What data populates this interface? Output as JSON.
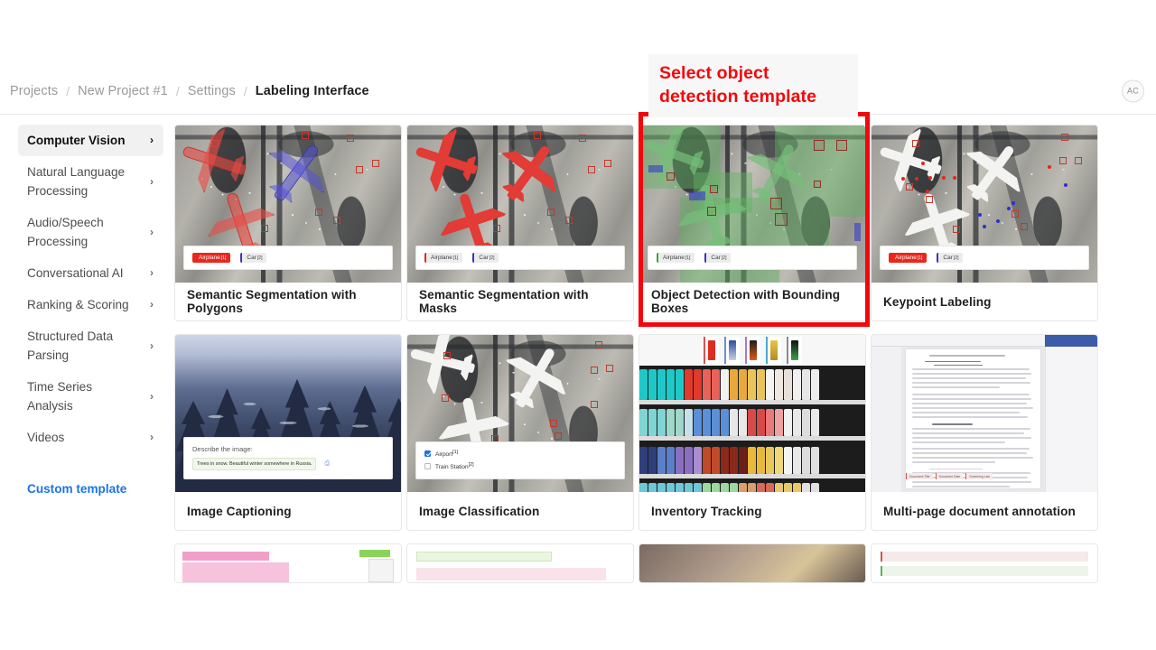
{
  "breadcrumb": {
    "items": [
      "Projects",
      "New Project #1",
      "Settings",
      "Labeling Interface"
    ],
    "separator": "/"
  },
  "account": {
    "initials": "AC"
  },
  "sidebar": {
    "items": [
      {
        "label": "Computer Vision",
        "active": true
      },
      {
        "label": "Natural Language Processing",
        "active": false
      },
      {
        "label": "Audio/Speech Processing",
        "active": false
      },
      {
        "label": "Conversational AI",
        "active": false
      },
      {
        "label": "Ranking & Scoring",
        "active": false
      },
      {
        "label": "Structured Data Parsing",
        "active": false
      },
      {
        "label": "Time Series Analysis",
        "active": false
      },
      {
        "label": "Videos",
        "active": false
      }
    ],
    "custom_template": "Custom template",
    "chevron": "›"
  },
  "annotation": {
    "text": "Select object detection template",
    "color": "#f4060b",
    "target_card": "Object Detection with Bounding Boxes"
  },
  "templates": [
    {
      "title": "Semantic Segmentation with Polygons",
      "chips": [
        {
          "text": "Airplane",
          "sup": "[1]"
        },
        {
          "text": "Car",
          "sup": "[2]"
        }
      ]
    },
    {
      "title": "Semantic Segmentation with Masks",
      "chips": [
        {
          "text": "Airplane",
          "sup": "[1]"
        },
        {
          "text": "Car",
          "sup": "[2]"
        }
      ]
    },
    {
      "title": "Object Detection with Bounding Boxes",
      "chips": [
        {
          "text": "Airplane",
          "sup": "[1]"
        },
        {
          "text": "Car",
          "sup": "[2]"
        }
      ]
    },
    {
      "title": "Keypoint Labeling",
      "chips": [
        {
          "text": "Airplane",
          "sup": "[1]"
        },
        {
          "text": "Car",
          "sup": "[2]"
        }
      ]
    },
    {
      "title": "Image Captioning",
      "caption_label": "Describe the image:",
      "caption_value": "Trees in snow. Beautiful winter somewhere in Russia."
    },
    {
      "title": "Image Classification",
      "options": [
        {
          "text": "Airport",
          "sup": "[1]",
          "checked": true
        },
        {
          "text": "Train Station",
          "sup": "[2]",
          "checked": false
        }
      ]
    },
    {
      "title": "Inventory Tracking"
    },
    {
      "title": "Multi-page document annotation"
    }
  ]
}
